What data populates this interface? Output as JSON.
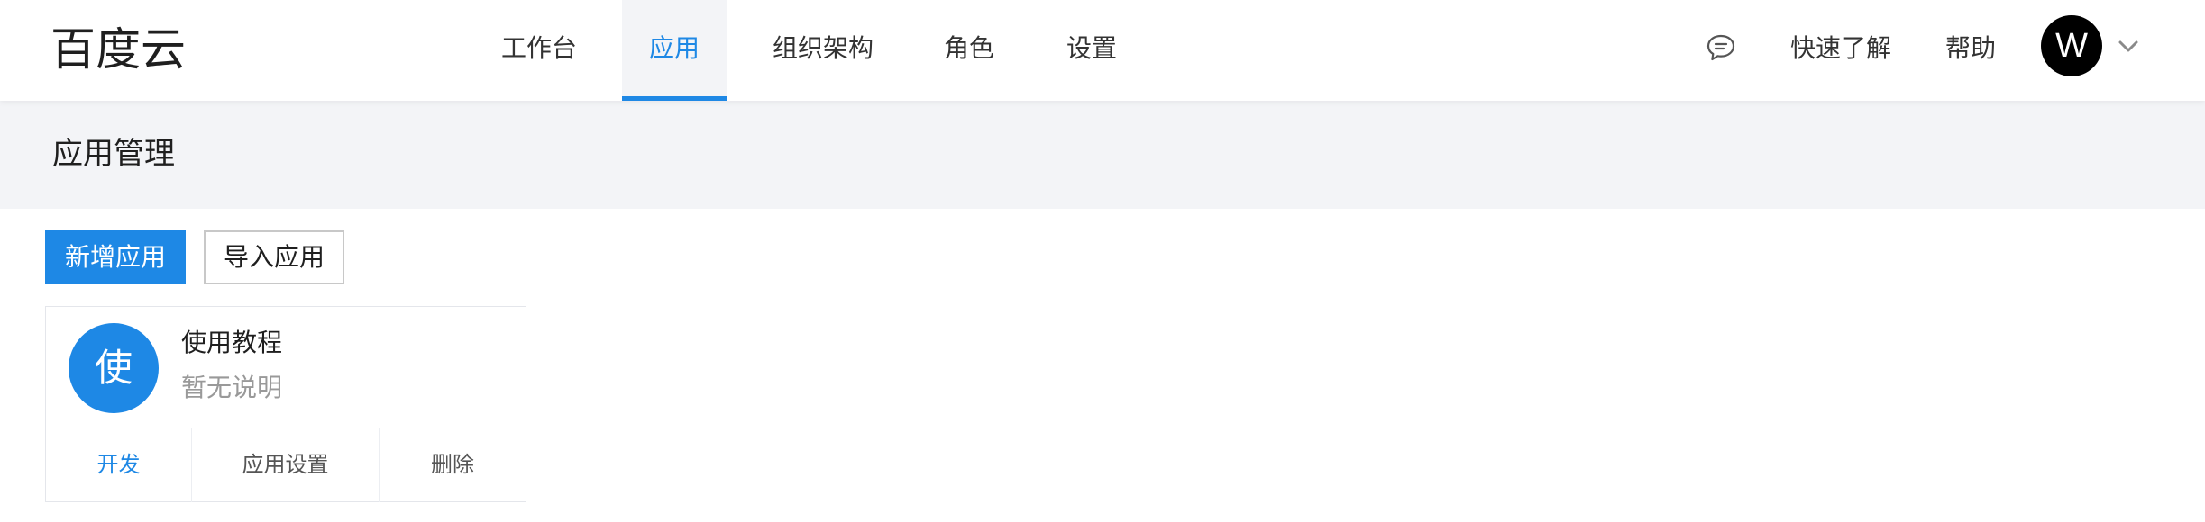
{
  "brand": {
    "name": "百度云"
  },
  "nav": {
    "items": [
      {
        "label": "工作台",
        "active": false
      },
      {
        "label": "应用",
        "active": true
      },
      {
        "label": "组织架构",
        "active": false
      },
      {
        "label": "角色",
        "active": false
      },
      {
        "label": "设置",
        "active": false
      }
    ]
  },
  "header_right": {
    "message_icon": "chat-bubble-icon",
    "quick_start": "快速了解",
    "help": "帮助",
    "avatar_letter": "W",
    "dropdown_icon": "chevron-down-icon"
  },
  "page": {
    "title": "应用管理"
  },
  "toolbar": {
    "add_label": "新增应用",
    "import_label": "导入应用"
  },
  "apps": [
    {
      "avatar_char": "使",
      "name": "使用教程",
      "description": "暂无说明",
      "actions": {
        "develop": "开发",
        "settings": "应用设置",
        "delete": "删除"
      }
    }
  ],
  "colors": {
    "accent": "#1e88e5",
    "header_bg": "#f3f4f7",
    "avatar_bg": "#000000"
  }
}
